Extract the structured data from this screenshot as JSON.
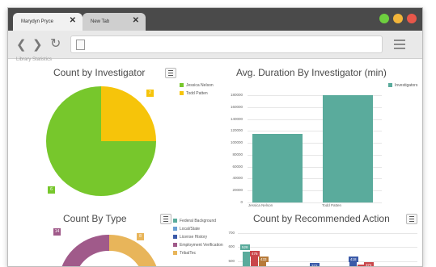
{
  "browser": {
    "tabs": [
      {
        "label": "Marydyn Pryce"
      },
      {
        "label": "New Tab"
      }
    ],
    "close_glyph": "✕",
    "window_dots": [
      "#6ecf3f",
      "#f2b53a",
      "#e8574a"
    ],
    "nav": {
      "back": "❮",
      "forward": "❯",
      "reload": "↻"
    }
  },
  "page": {
    "breadcrumb": "Library Statistics"
  },
  "panels": {
    "count_by_investigator": {
      "title": "Count by Investigator",
      "legend": [
        "Jessica Nelson",
        "Todd Patten"
      ],
      "colors": [
        "#77c72c",
        "#f6c40a"
      ],
      "chart_data": {
        "type": "pie",
        "categories": [
          "Jessica Nelson",
          "Todd Patten"
        ],
        "values": [
          6,
          2
        ]
      },
      "labels": [
        "6",
        "2"
      ]
    },
    "avg_duration": {
      "title": "Avg. Duration By Investigator (min)",
      "legend": [
        "Investigators"
      ],
      "color": "#5aab9c",
      "chart_data": {
        "type": "bar",
        "categories": [
          "Jessica Nelson",
          "Todd Patten"
        ],
        "values": [
          115000,
          180000
        ],
        "ylim": [
          0,
          180000
        ]
      },
      "ticks": [
        "180000",
        "160000",
        "140000",
        "120000",
        "100000",
        "80000",
        "60000",
        "40000",
        "20000",
        "0"
      ]
    },
    "count_by_type": {
      "title": "Count By Type",
      "legend": [
        "Federal Background",
        "Local/State",
        "License History",
        "Employment Verification",
        "TribalTec"
      ],
      "colors": [
        "#5aab9c",
        "#6a9fd4",
        "#3b5aa8",
        "#a05a8a",
        "#e8b55a"
      ],
      "labels": [
        "14",
        "8"
      ]
    },
    "recommended_action": {
      "title": "Count by Recommended Action",
      "ticks": [
        "700",
        "600",
        "500"
      ],
      "bar_labels": [
        "528",
        "476",
        "433",
        "372",
        "418",
        "374"
      ],
      "colors": [
        "#5aab9c",
        "#c9464a",
        "#b77b3a",
        "#3b5aa8",
        "#7a3a6e"
      ]
    }
  }
}
